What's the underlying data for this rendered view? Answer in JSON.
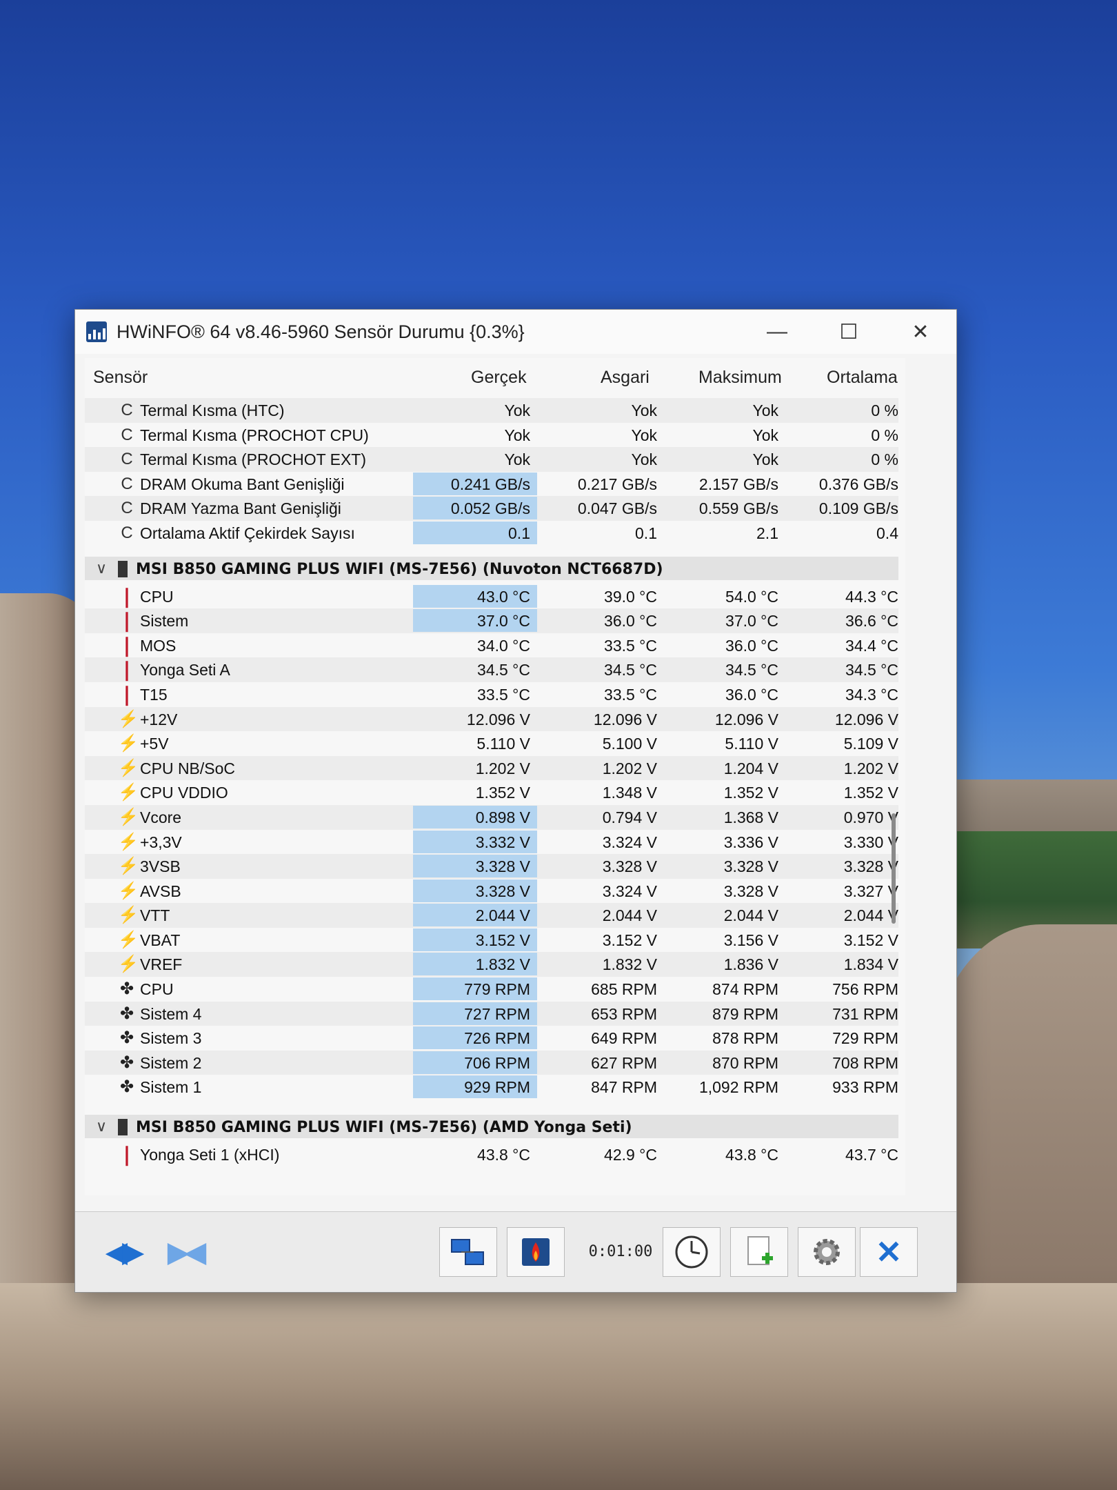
{
  "window": {
    "title": "HWiNFO® 64 v8.46-5960 Sensör Durumu {0.3%}",
    "minimize": "—",
    "maximize": "☐",
    "close": "✕"
  },
  "columns": {
    "sensor": "Sensör",
    "current": "Gerçek",
    "min": "Asgari",
    "max": "Maksimum",
    "avg": "Ortalama"
  },
  "rows_top": [
    {
      "name": "Termal Kısma (HTC)",
      "c": "Yok",
      "min": "Yok",
      "max": "Yok",
      "avg": "0 %"
    },
    {
      "name": "Termal Kısma (PROCHOT CPU)",
      "c": "Yok",
      "min": "Yok",
      "max": "Yok",
      "avg": "0 %"
    },
    {
      "name": "Termal Kısma (PROCHOT EXT)",
      "c": "Yok",
      "min": "Yok",
      "max": "Yok",
      "avg": "0 %"
    },
    {
      "name": "DRAM Okuma Bant Genişliği",
      "c": "0.241 GB/s",
      "min": "0.217 GB/s",
      "max": "2.157 GB/s",
      "avg": "0.376 GB/s"
    },
    {
      "name": "DRAM Yazma Bant Genişliği",
      "c": "0.052 GB/s",
      "min": "0.047 GB/s",
      "max": "0.559 GB/s",
      "avg": "0.109 GB/s"
    },
    {
      "name": "Ortalama Aktif Çekirdek Sayısı",
      "c": "0.1",
      "min": "0.1",
      "max": "2.1",
      "avg": "0.4"
    }
  ],
  "section1": {
    "title": "MSI B850 GAMING PLUS WIFI (MS-7E56) (Nuvoton NCT6687D)"
  },
  "rows_s1": [
    {
      "name": "CPU",
      "c": "43.0 °C",
      "min": "39.0 °C",
      "max": "54.0 °C",
      "avg": "44.3 °C"
    },
    {
      "name": "Sistem",
      "c": "37.0 °C",
      "min": "36.0 °C",
      "max": "37.0 °C",
      "avg": "36.6 °C"
    },
    {
      "name": "MOS",
      "c": "34.0 °C",
      "min": "33.5 °C",
      "max": "36.0 °C",
      "avg": "34.4 °C"
    },
    {
      "name": "Yonga Seti A",
      "c": "34.5 °C",
      "min": "34.5 °C",
      "max": "34.5 °C",
      "avg": "34.5 °C"
    },
    {
      "name": "T15",
      "c": "33.5 °C",
      "min": "33.5 °C",
      "max": "36.0 °C",
      "avg": "34.3 °C"
    },
    {
      "name": "+12V",
      "c": "12.096 V",
      "min": "12.096 V",
      "max": "12.096 V",
      "avg": "12.096 V"
    },
    {
      "name": "+5V",
      "c": "5.110 V",
      "min": "5.100 V",
      "max": "5.110 V",
      "avg": "5.109 V"
    },
    {
      "name": "CPU NB/SoC",
      "c": "1.202 V",
      "min": "1.202 V",
      "max": "1.204 V",
      "avg": "1.202 V"
    },
    {
      "name": "CPU VDDIO",
      "c": "1.352 V",
      "min": "1.348 V",
      "max": "1.352 V",
      "avg": "1.352 V"
    },
    {
      "name": "Vcore",
      "c": "0.898 V",
      "min": "0.794 V",
      "max": "1.368 V",
      "avg": "0.970 V"
    },
    {
      "name": "+3,3V",
      "c": "3.332 V",
      "min": "3.324 V",
      "max": "3.336 V",
      "avg": "3.330 V"
    },
    {
      "name": "3VSB",
      "c": "3.328 V",
      "min": "3.328 V",
      "max": "3.328 V",
      "avg": "3.328 V"
    },
    {
      "name": "AVSB",
      "c": "3.328 V",
      "min": "3.324 V",
      "max": "3.328 V",
      "avg": "3.327 V"
    },
    {
      "name": "VTT",
      "c": "2.044 V",
      "min": "2.044 V",
      "max": "2.044 V",
      "avg": "2.044 V"
    },
    {
      "name": "VBAT",
      "c": "3.152 V",
      "min": "3.152 V",
      "max": "3.156 V",
      "avg": "3.152 V"
    },
    {
      "name": "VREF",
      "c": "1.832 V",
      "min": "1.832 V",
      "max": "1.836 V",
      "avg": "1.834 V"
    },
    {
      "name": "CPU",
      "c": "779 RPM",
      "min": "685 RPM",
      "max": "874 RPM",
      "avg": "756 RPM"
    },
    {
      "name": "Sistem 4",
      "c": "727 RPM",
      "min": "653 RPM",
      "max": "879 RPM",
      "avg": "731 RPM"
    },
    {
      "name": "Sistem 3",
      "c": "726 RPM",
      "min": "649 RPM",
      "max": "878 RPM",
      "avg": "729 RPM"
    },
    {
      "name": "Sistem 2",
      "c": "706 RPM",
      "min": "627 RPM",
      "max": "870 RPM",
      "avg": "708 RPM"
    },
    {
      "name": "Sistem 1",
      "c": "929 RPM",
      "min": "847 RPM",
      "max": "1,092 RPM",
      "avg": "933 RPM"
    }
  ],
  "section2": {
    "title": "MSI B850 GAMING PLUS WIFI (MS-7E56) (AMD Yonga Seti)"
  },
  "rows_s2": [
    {
      "name": "Yonga Seti 1 (xHCI)",
      "c": "43.8 °C",
      "min": "42.9 °C",
      "max": "43.8 °C",
      "avg": "43.7 °C"
    }
  ],
  "toolbar": {
    "timer": "0:01:00"
  },
  "icons": {
    "clock": "clock-icon",
    "temp": "thermometer-icon",
    "volt": "lightning-icon",
    "fan": "fan-icon"
  },
  "colors": {
    "highlight": "#b3d4f0",
    "accent": "#1f6fd1",
    "temp": "#c0182a",
    "volt": "#e79a10"
  }
}
